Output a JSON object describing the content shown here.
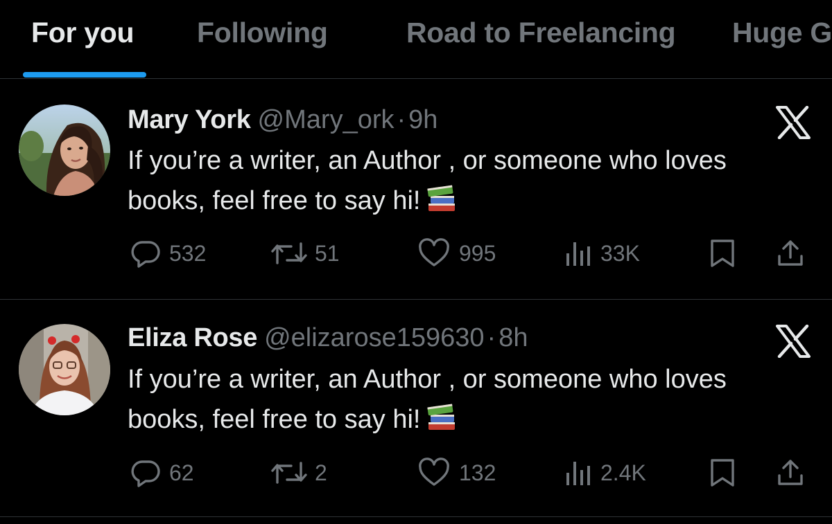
{
  "tabs": [
    {
      "label": "For you",
      "active": true
    },
    {
      "label": "Following",
      "active": false
    },
    {
      "label": "Road to Freelancing",
      "active": false
    },
    {
      "label": "Huge G",
      "active": false
    }
  ],
  "colors": {
    "background": "#000000",
    "text_primary": "#e7e9ea",
    "text_secondary": "#71767b",
    "accent": "#1d9bf0",
    "divider": "#2f3336"
  },
  "posts": [
    {
      "author_name": "Mary York",
      "handle": "@Mary_ork",
      "separator": "·",
      "time": "9h",
      "text": "If you’re a writer, an Author , or someone who loves books, feel free to say hi!",
      "emoji_icon": "books-icon",
      "actions": {
        "replies": "532",
        "reposts": "51",
        "likes": "995",
        "views": "33K"
      }
    },
    {
      "author_name": "Eliza Rose",
      "handle": "@elizarose159630",
      "separator": "·",
      "time": "8h",
      "text": "If you’re a writer, an Author , or someone who loves books, feel free to say hi!",
      "emoji_icon": "books-icon",
      "actions": {
        "replies": "62",
        "reposts": "2",
        "likes": "132",
        "views": "2.4K"
      }
    }
  ],
  "icons": {
    "platform_logo": "x-logo-icon",
    "reply": "reply-icon",
    "repost": "repost-icon",
    "like": "heart-icon",
    "views": "views-icon",
    "bookmark": "bookmark-icon",
    "share": "share-icon"
  }
}
